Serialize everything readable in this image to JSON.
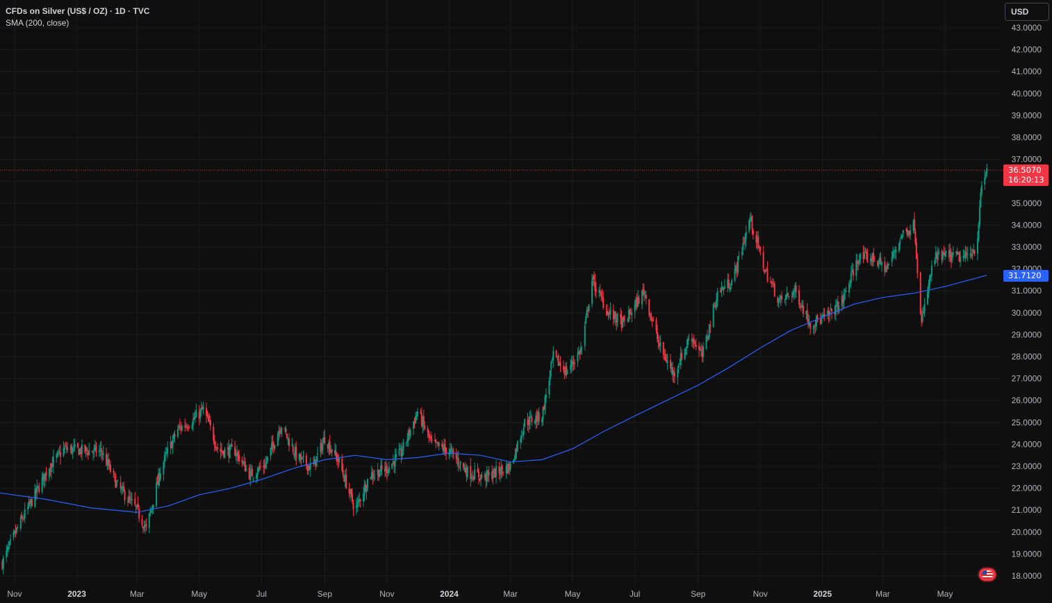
{
  "legend": {
    "title": "CFDs on Silver (US$ / OZ) · 1D · TVC",
    "indicator": "SMA (200, close)"
  },
  "currency_button": "USD",
  "last_price": {
    "value": "36.5070",
    "countdown": "16:20:13"
  },
  "sma_value": "31.7120",
  "colors": {
    "background": "#0f0f0f",
    "grid": "#1e1e1e",
    "up": "#089981",
    "down": "#f23645",
    "sma": "#2962ff",
    "axis_text": "#b2b5be"
  },
  "chart_data": {
    "type": "candlestick",
    "title": "CFDs on Silver (US$ / OZ) · 1D · TVC",
    "x_axis": {
      "ticks": [
        {
          "label": "Nov",
          "date": "2022-11-01",
          "bold": false
        },
        {
          "label": "2023",
          "date": "2023-01-01",
          "bold": true
        },
        {
          "label": "Mar",
          "date": "2023-03-01",
          "bold": false
        },
        {
          "label": "May",
          "date": "2023-05-01",
          "bold": false
        },
        {
          "label": "Jul",
          "date": "2023-07-01",
          "bold": false
        },
        {
          "label": "Sep",
          "date": "2023-09-01",
          "bold": false
        },
        {
          "label": "Nov",
          "date": "2023-11-01",
          "bold": false
        },
        {
          "label": "2024",
          "date": "2024-01-01",
          "bold": true
        },
        {
          "label": "Mar",
          "date": "2024-03-01",
          "bold": false
        },
        {
          "label": "May",
          "date": "2024-05-01",
          "bold": false
        },
        {
          "label": "Jul",
          "date": "2024-07-01",
          "bold": false
        },
        {
          "label": "Sep",
          "date": "2024-09-01",
          "bold": false
        },
        {
          "label": "Nov",
          "date": "2024-11-01",
          "bold": false
        },
        {
          "label": "2025",
          "date": "2025-01-01",
          "bold": true
        },
        {
          "label": "Mar",
          "date": "2025-03-01",
          "bold": false
        },
        {
          "label": "May",
          "date": "2025-05-01",
          "bold": false
        }
      ]
    },
    "y_axis": {
      "range": [
        17.6,
        43.4
      ],
      "ticks": [
        "18.0000",
        "19.0000",
        "20.0000",
        "21.0000",
        "22.0000",
        "23.0000",
        "24.0000",
        "25.0000",
        "26.0000",
        "27.0000",
        "28.0000",
        "29.0000",
        "30.0000",
        "31.0000",
        "32.0000",
        "33.0000",
        "34.0000",
        "35.0000",
        "36.0000",
        "37.0000",
        "38.0000",
        "39.0000",
        "40.0000",
        "41.0000",
        "42.0000",
        "43.0000"
      ]
    },
    "grid": true,
    "last_price": 36.507,
    "series": [
      {
        "name": "CFDs on Silver (US$ / OZ)",
        "type": "candlestick",
        "approx_closes": [
          {
            "date": "2022-10-20",
            "value": 18.6
          },
          {
            "date": "2022-11-05",
            "value": 20.3
          },
          {
            "date": "2022-11-20",
            "value": 21.6
          },
          {
            "date": "2022-12-05",
            "value": 23.0
          },
          {
            "date": "2022-12-20",
            "value": 23.8
          },
          {
            "date": "2023-01-10",
            "value": 23.7
          },
          {
            "date": "2023-01-25",
            "value": 23.7
          },
          {
            "date": "2023-02-10",
            "value": 22.1
          },
          {
            "date": "2023-03-01",
            "value": 21.0
          },
          {
            "date": "2023-03-10",
            "value": 20.1
          },
          {
            "date": "2023-03-25",
            "value": 23.0
          },
          {
            "date": "2023-04-10",
            "value": 24.7
          },
          {
            "date": "2023-04-25",
            "value": 25.1
          },
          {
            "date": "2023-05-05",
            "value": 25.6
          },
          {
            "date": "2023-05-20",
            "value": 23.7
          },
          {
            "date": "2023-06-05",
            "value": 23.7
          },
          {
            "date": "2023-06-20",
            "value": 22.6
          },
          {
            "date": "2023-07-05",
            "value": 23.1
          },
          {
            "date": "2023-07-20",
            "value": 24.9
          },
          {
            "date": "2023-08-05",
            "value": 23.4
          },
          {
            "date": "2023-08-20",
            "value": 22.9
          },
          {
            "date": "2023-09-01",
            "value": 24.3
          },
          {
            "date": "2023-09-15",
            "value": 23.2
          },
          {
            "date": "2023-10-01",
            "value": 21.0
          },
          {
            "date": "2023-10-15",
            "value": 22.6
          },
          {
            "date": "2023-11-01",
            "value": 22.9
          },
          {
            "date": "2023-11-15",
            "value": 23.6
          },
          {
            "date": "2023-12-01",
            "value": 25.5
          },
          {
            "date": "2023-12-15",
            "value": 24.0
          },
          {
            "date": "2024-01-01",
            "value": 23.7
          },
          {
            "date": "2024-01-20",
            "value": 22.7
          },
          {
            "date": "2024-02-05",
            "value": 22.5
          },
          {
            "date": "2024-02-20",
            "value": 22.8
          },
          {
            "date": "2024-03-01",
            "value": 23.0
          },
          {
            "date": "2024-03-15",
            "value": 25.0
          },
          {
            "date": "2024-04-01",
            "value": 25.3
          },
          {
            "date": "2024-04-12",
            "value": 28.0
          },
          {
            "date": "2024-04-25",
            "value": 27.3
          },
          {
            "date": "2024-05-10",
            "value": 28.4
          },
          {
            "date": "2024-05-20",
            "value": 31.5
          },
          {
            "date": "2024-06-05",
            "value": 30.0
          },
          {
            "date": "2024-06-20",
            "value": 29.5
          },
          {
            "date": "2024-07-10",
            "value": 31.0
          },
          {
            "date": "2024-07-25",
            "value": 28.5
          },
          {
            "date": "2024-08-08",
            "value": 27.2
          },
          {
            "date": "2024-08-25",
            "value": 29.0
          },
          {
            "date": "2024-09-05",
            "value": 28.0
          },
          {
            "date": "2024-09-20",
            "value": 30.9
          },
          {
            "date": "2024-10-05",
            "value": 31.5
          },
          {
            "date": "2024-10-22",
            "value": 34.3
          },
          {
            "date": "2024-11-05",
            "value": 32.0
          },
          {
            "date": "2024-11-20",
            "value": 30.5
          },
          {
            "date": "2024-12-05",
            "value": 31.0
          },
          {
            "date": "2024-12-20",
            "value": 29.5
          },
          {
            "date": "2025-01-05",
            "value": 29.8
          },
          {
            "date": "2025-01-20",
            "value": 30.5
          },
          {
            "date": "2025-02-05",
            "value": 32.5
          },
          {
            "date": "2025-02-20",
            "value": 32.5
          },
          {
            "date": "2025-03-05",
            "value": 32.0
          },
          {
            "date": "2025-03-20",
            "value": 33.6
          },
          {
            "date": "2025-04-01",
            "value": 34.0
          },
          {
            "date": "2025-04-08",
            "value": 29.5
          },
          {
            "date": "2025-04-20",
            "value": 32.5
          },
          {
            "date": "2025-05-05",
            "value": 32.6
          },
          {
            "date": "2025-05-20",
            "value": 32.5
          },
          {
            "date": "2025-06-01",
            "value": 33.0
          },
          {
            "date": "2025-06-06",
            "value": 35.8
          },
          {
            "date": "2025-06-11",
            "value": 36.507
          }
        ]
      },
      {
        "name": "SMA (200, close)",
        "type": "line",
        "values": [
          {
            "date": "2022-10-15",
            "value": 21.8
          },
          {
            "date": "2022-12-01",
            "value": 21.5
          },
          {
            "date": "2023-01-15",
            "value": 21.1
          },
          {
            "date": "2023-03-01",
            "value": 20.9
          },
          {
            "date": "2023-04-01",
            "value": 21.2
          },
          {
            "date": "2023-05-01",
            "value": 21.7
          },
          {
            "date": "2023-06-01",
            "value": 22.0
          },
          {
            "date": "2023-07-01",
            "value": 22.4
          },
          {
            "date": "2023-08-01",
            "value": 22.9
          },
          {
            "date": "2023-09-01",
            "value": 23.3
          },
          {
            "date": "2023-10-01",
            "value": 23.5
          },
          {
            "date": "2023-11-01",
            "value": 23.3
          },
          {
            "date": "2023-12-01",
            "value": 23.4
          },
          {
            "date": "2024-01-01",
            "value": 23.6
          },
          {
            "date": "2024-02-01",
            "value": 23.5
          },
          {
            "date": "2024-03-01",
            "value": 23.2
          },
          {
            "date": "2024-04-01",
            "value": 23.3
          },
          {
            "date": "2024-05-01",
            "value": 23.8
          },
          {
            "date": "2024-06-01",
            "value": 24.6
          },
          {
            "date": "2024-07-01",
            "value": 25.3
          },
          {
            "date": "2024-08-01",
            "value": 26.0
          },
          {
            "date": "2024-09-01",
            "value": 26.7
          },
          {
            "date": "2024-10-01",
            "value": 27.5
          },
          {
            "date": "2024-11-01",
            "value": 28.4
          },
          {
            "date": "2024-12-01",
            "value": 29.2
          },
          {
            "date": "2025-01-01",
            "value": 29.8
          },
          {
            "date": "2025-02-01",
            "value": 30.4
          },
          {
            "date": "2025-03-01",
            "value": 30.7
          },
          {
            "date": "2025-04-01",
            "value": 30.9
          },
          {
            "date": "2025-05-01",
            "value": 31.2
          },
          {
            "date": "2025-06-11",
            "value": 31.712
          }
        ]
      }
    ]
  }
}
